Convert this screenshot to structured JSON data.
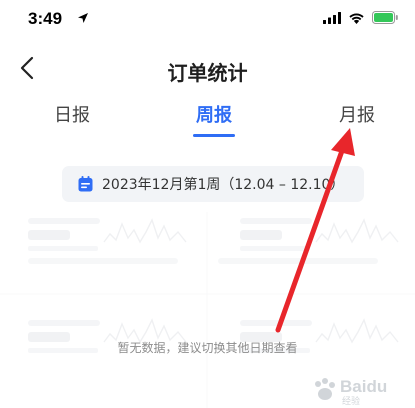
{
  "status_bar": {
    "time": "3:49",
    "icons": [
      "location-arrow-icon",
      "cellular-signal-icon",
      "wifi-icon",
      "battery-icon"
    ],
    "battery_color": "#34c759"
  },
  "nav": {
    "title": "订单统计",
    "back_icon": "chevron-left-icon"
  },
  "tabs": [
    {
      "label": "日报",
      "active": false
    },
    {
      "label": "周报",
      "active": true
    },
    {
      "label": "月报",
      "active": false
    }
  ],
  "accent_color": "#2f6df5",
  "date_selector": {
    "icon": "calendar-icon",
    "label": "2023年12月第1周（12.04 – 12.10）"
  },
  "empty_state": {
    "message": "暂无数据，建议切换其他日期查看"
  },
  "annotation": {
    "arrow_color": "#e8262b",
    "points_to": "月报"
  },
  "watermark": {
    "text": "Baidu",
    "subtext": "经验"
  }
}
